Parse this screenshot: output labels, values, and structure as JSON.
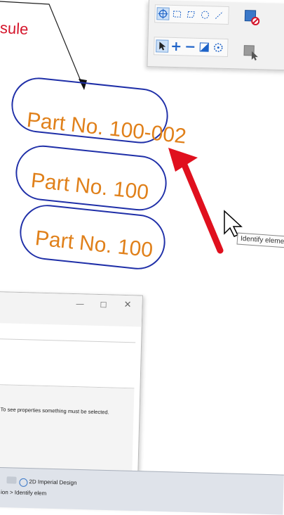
{
  "canvas": {
    "callout_label": "sule",
    "capsules": [
      {
        "text": "Part No. 100-002"
      },
      {
        "text": "Part No. 100"
      },
      {
        "text": "Part No. 100"
      }
    ]
  },
  "tooltip": {
    "text": "Identify eleme"
  },
  "palette": {
    "row1_icons": [
      "select-element-icon",
      "fence-block-icon",
      "fence-shape-icon",
      "fence-circle-icon",
      "fence-line-icon"
    ],
    "row2_icons": [
      "element-selection-icon",
      "add-icon",
      "subtract-icon",
      "invert-icon",
      "clear-icon"
    ]
  },
  "dialog": {
    "message": "To see properties something must be selected."
  },
  "statusbar": {
    "breadcrumb": "ion > Identify elem",
    "model_name": "2D Imperial Design"
  },
  "colors": {
    "capsule_border": "#1f2fa8",
    "capsule_text": "#e0801a",
    "red_label": "#d4142a",
    "arrow_red": "#e0101e"
  }
}
